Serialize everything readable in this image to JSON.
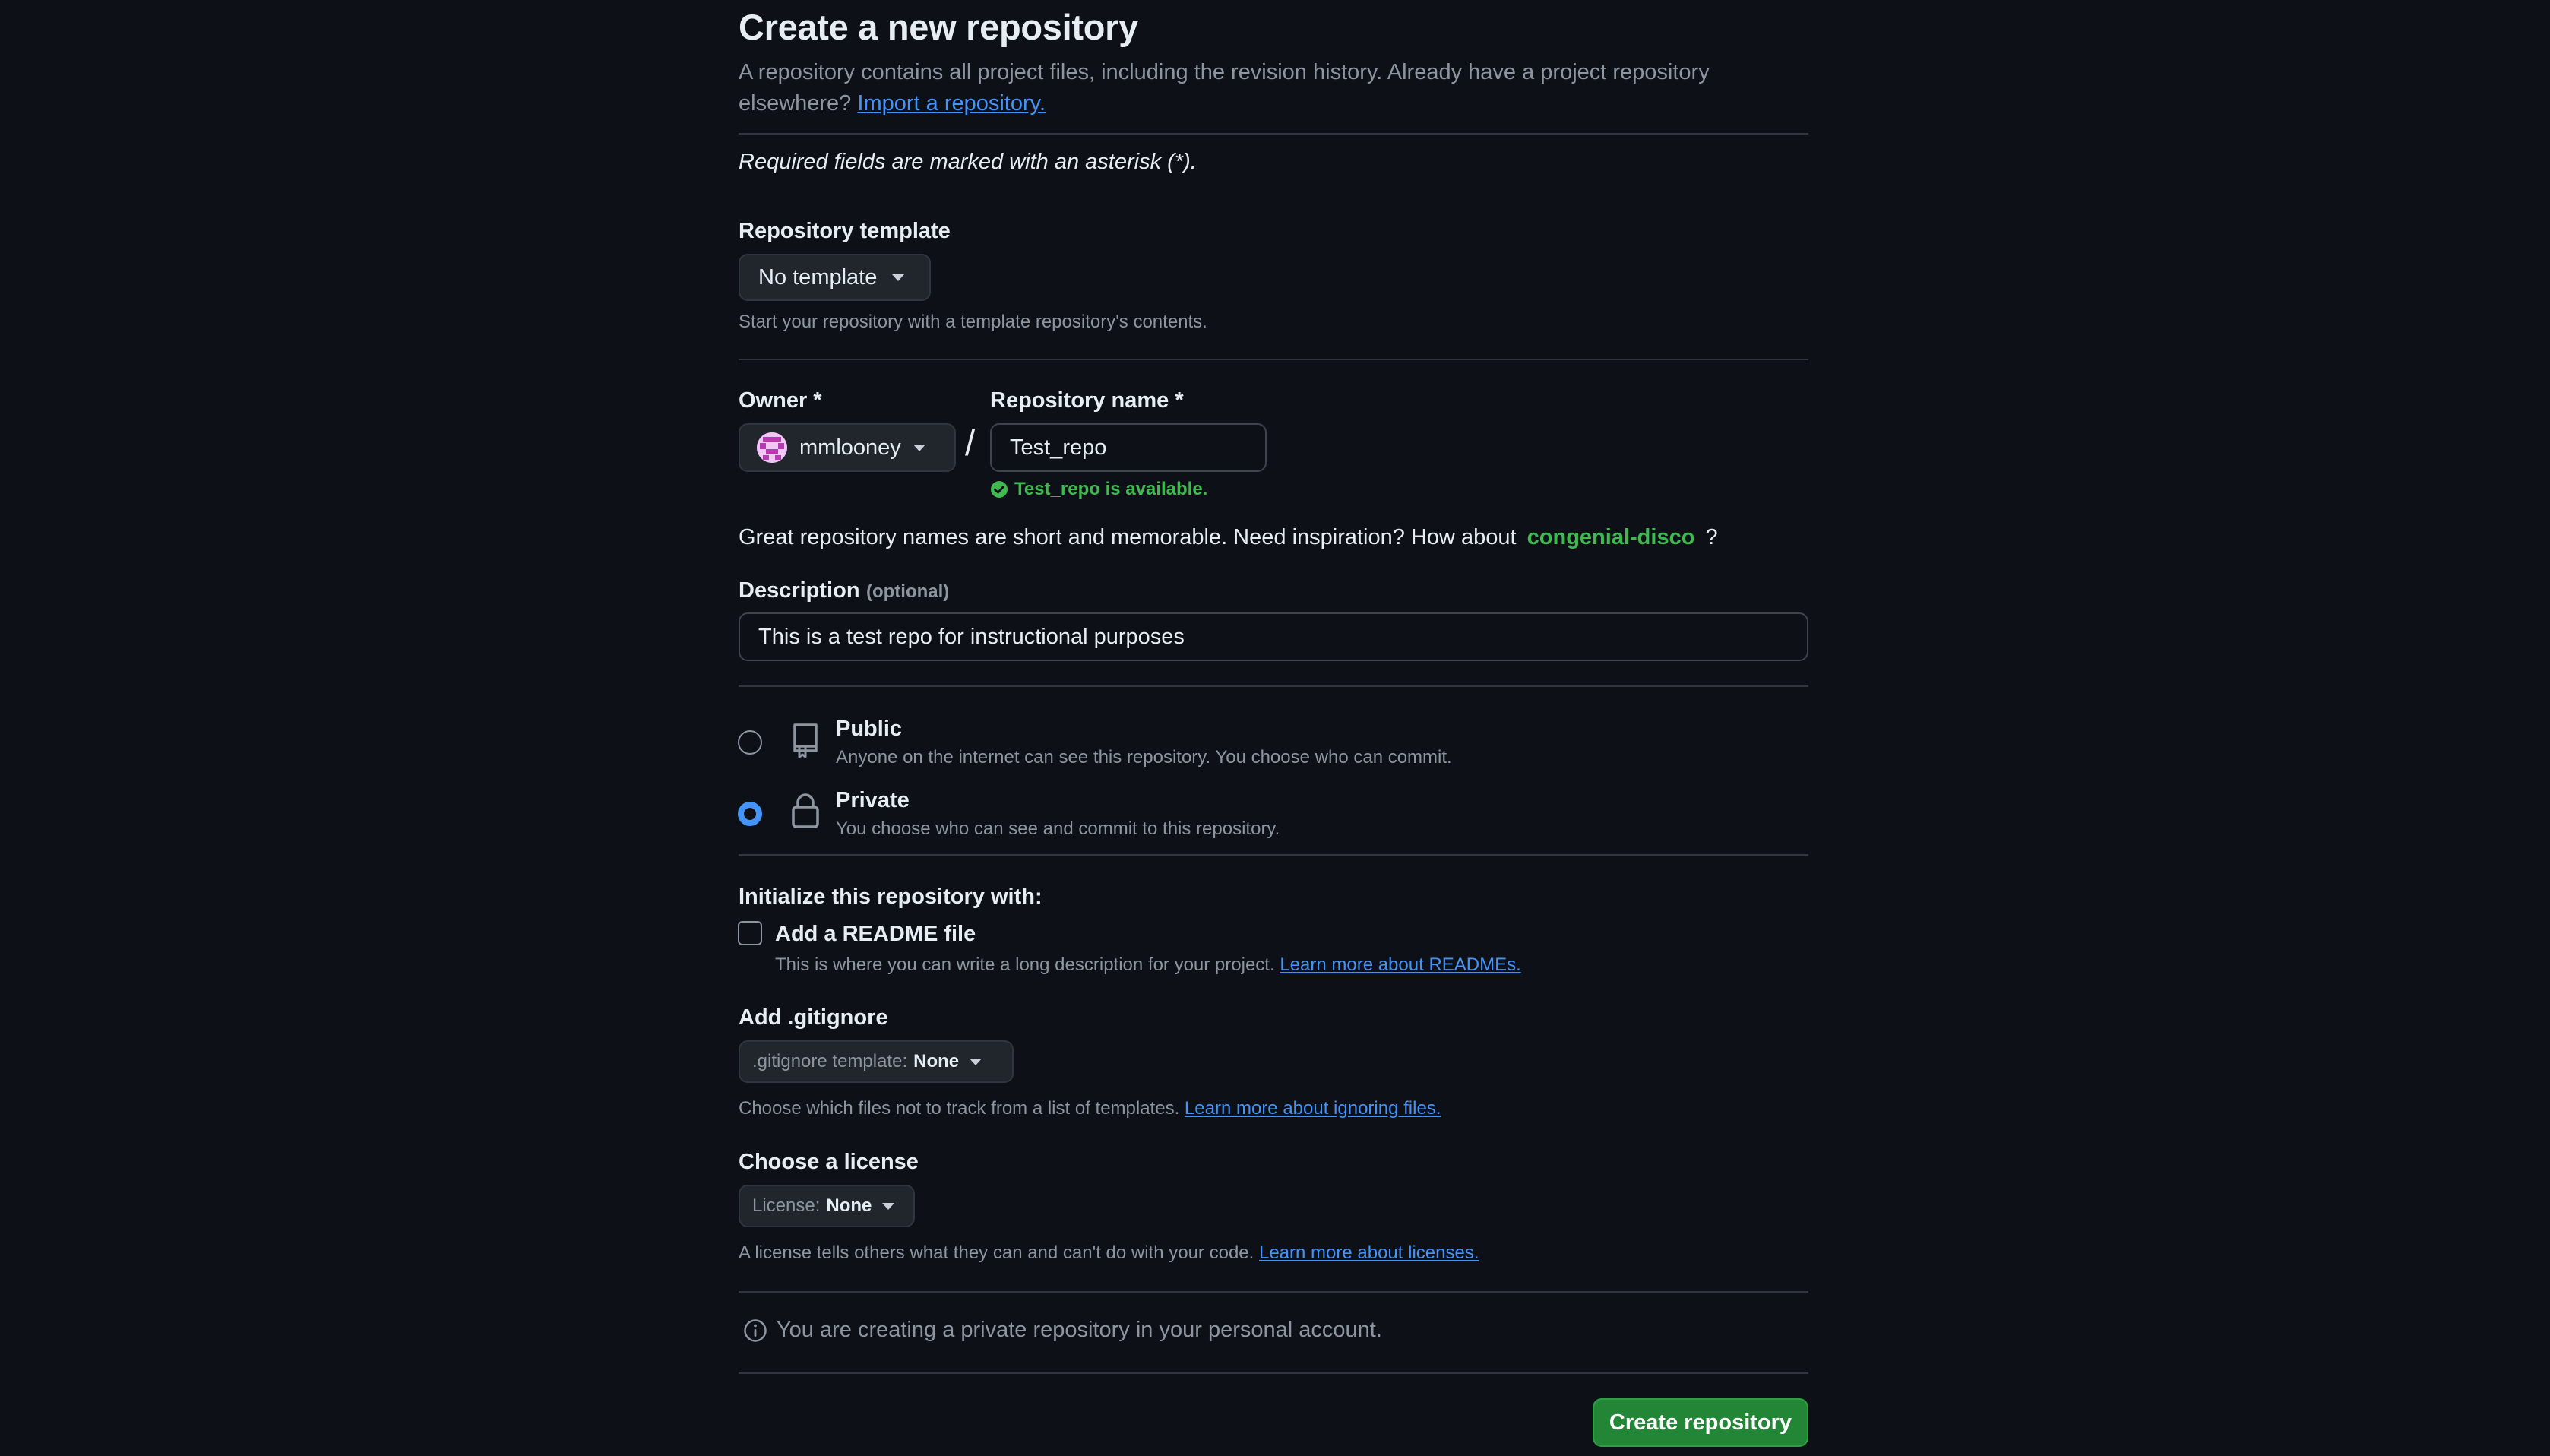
{
  "header": {
    "title": "Create a new repository",
    "lead": "A repository contains all project files, including the revision history. Already have a project repository elsewhere?",
    "import_link": "Import a repository."
  },
  "required_note": "Required fields are marked with an asterisk (*).",
  "template": {
    "label": "Repository template",
    "selected": "No template",
    "help": "Start your repository with a template repository's contents."
  },
  "owner": {
    "label": "Owner *",
    "selected": "mmlooney"
  },
  "separator": "/",
  "repo_name": {
    "label": "Repository name *",
    "value": "Test_repo",
    "availability": "Test_repo is available."
  },
  "inspiration": {
    "text": "Great repository names are short and memorable. Need inspiration? How about",
    "suggestion": "congenial-disco",
    "suffix": "?"
  },
  "description": {
    "label": "Description",
    "optional": "(optional)",
    "value": "This is a test repo for instructional purposes"
  },
  "visibility": {
    "selected": "Private",
    "options": [
      {
        "title": "Public",
        "desc": "Anyone on the internet can see this repository. You choose who can commit."
      },
      {
        "title": "Private",
        "desc": "You choose who can see and commit to this repository."
      }
    ]
  },
  "initialize": {
    "heading": "Initialize this repository with:",
    "readme_label": "Add a README file",
    "readme_checked": false,
    "readme_help": "This is where you can write a long description for your project.",
    "readme_link": "Learn more about READMEs."
  },
  "gitignore": {
    "heading": "Add .gitignore",
    "prefix": ".gitignore template:",
    "value": "None",
    "help": "Choose which files not to track from a list of templates.",
    "link": "Learn more about ignoring files."
  },
  "license": {
    "heading": "Choose a license",
    "prefix": "License:",
    "value": "None",
    "help": "A license tells others what they can and can't do with your code.",
    "link": "Learn more about licenses."
  },
  "notice": "You are creating a private repository in your personal account.",
  "submit_label": "Create repository",
  "colors": {
    "background": "#0d1117",
    "accent": "#4493f8",
    "success": "#3fb950",
    "primary_button": "#238636"
  }
}
